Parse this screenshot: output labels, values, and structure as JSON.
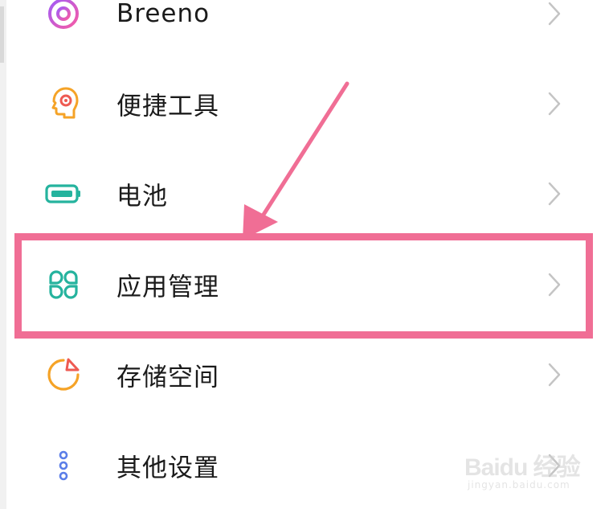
{
  "settings": {
    "items": [
      {
        "label": "Breeno",
        "icon": "breeno-icon"
      },
      {
        "label": "便捷工具",
        "icon": "convenience-tools-icon"
      },
      {
        "label": "电池",
        "icon": "battery-icon"
      },
      {
        "label": "应用管理",
        "icon": "app-management-icon"
      },
      {
        "label": "存储空间",
        "icon": "storage-icon"
      },
      {
        "label": "其他设置",
        "icon": "other-settings-icon"
      }
    ]
  },
  "colors": {
    "annotation_pink": "#f06e95",
    "breeno_gradient_start": "#a25bf7",
    "breeno_gradient_end": "#f75ba5",
    "tools_orange": "#f5a327",
    "battery_teal": "#25b39e",
    "apps_teal": "#25b39e",
    "storage_orange": "#f5a327",
    "storage_red": "#ee5a52",
    "other_blue": "#5b7ee8",
    "chevron_gray": "#c4c4c4"
  },
  "watermark": {
    "main": "Baidu 经验",
    "sub": "jingyan.baidu.com"
  }
}
